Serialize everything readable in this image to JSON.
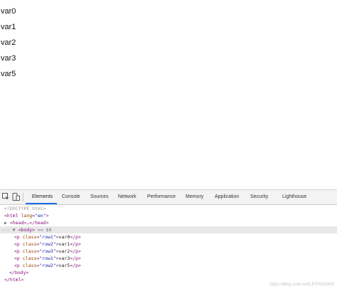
{
  "viewport": {
    "paragraphs": [
      "var0",
      "var1",
      "var2",
      "var3",
      "var5"
    ]
  },
  "devtools": {
    "tabs": {
      "elements": "Elements",
      "console": "Console",
      "sources": "Sources",
      "network": "Network",
      "performance": "Performance",
      "memory": "Memory",
      "application": "Application",
      "security": "Security",
      "lighthouse": "Lighthouse"
    },
    "active_tab": "Elements",
    "accent_color": "#1a73e8",
    "icons": {
      "inspect": "inspect-element-icon",
      "device": "device-toolbar-icon"
    },
    "dom": {
      "doctype": "<!DOCTYPE html>",
      "html_open_tag": "<html",
      "lang_attr": "lang",
      "lang_value": "\"en\"",
      "gt": ">",
      "head": "<head>…</head>",
      "body_tag": "<body>",
      "body_marker": "== $0",
      "p_open": "<p",
      "class_attr": "class",
      "p_close": "</p>",
      "rows": [
        {
          "cls": "\"row1\"",
          "text": "var0"
        },
        {
          "cls": "\"row2\"",
          "text": "var1"
        },
        {
          "cls": "\"row3\"",
          "text": "var2"
        },
        {
          "cls": "\"row1\"",
          "text": "var3"
        },
        {
          "cls": "\"row2\"",
          "text": "var5"
        }
      ],
      "body_close": "</body>",
      "html_close": "</html>"
    },
    "watermark": "https://blog.csdn.net/LIFENG0402"
  }
}
